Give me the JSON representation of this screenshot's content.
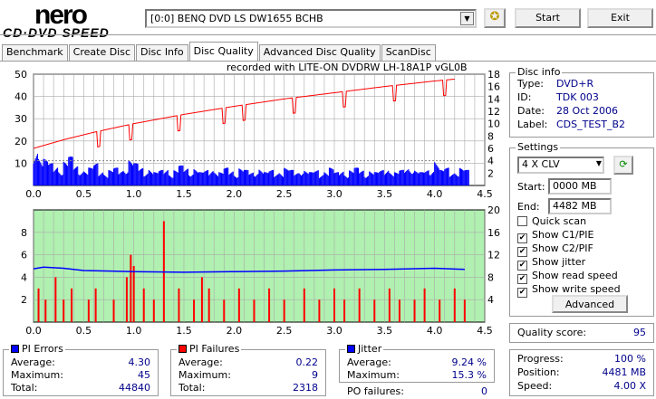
{
  "app": {
    "logo_top": "nero",
    "logo_bottom": "CD·DVD SPEED"
  },
  "toolbar": {
    "drive": "[0:0]  BENQ DVD LS DW1655 BCHB",
    "start_label": "Start",
    "exit_label": "Exit"
  },
  "tabs": [
    {
      "label": "Benchmark"
    },
    {
      "label": "Create Disc"
    },
    {
      "label": "Disc Info"
    },
    {
      "label": "Disc Quality",
      "active": true
    },
    {
      "label": "Advanced Disc Quality"
    },
    {
      "label": "ScanDisc"
    }
  ],
  "recorded_with": "recorded with LITE-ON DVDRW LH-18A1P    vGL0B",
  "disc_info": {
    "title": "Disc info",
    "type_label": "Type:",
    "type": "DVD+R",
    "id_label": "ID:",
    "id": "TDK 003",
    "date_label": "Date:",
    "date": "28 Oct 2006",
    "label_label": "Label:",
    "label": "CDS_TEST_B2"
  },
  "settings": {
    "title": "Settings",
    "speed": "4 X CLV",
    "start_label": "Start:",
    "start": "0000 MB",
    "end_label": "End:",
    "end": "4482 MB",
    "options": [
      {
        "label": "Quick scan",
        "checked": false
      },
      {
        "label": "Show C1/PIE",
        "checked": true
      },
      {
        "label": "Show C2/PIF",
        "checked": true
      },
      {
        "label": "Show jitter",
        "checked": true
      },
      {
        "label": "Show read speed",
        "checked": true
      },
      {
        "label": "Show write speed",
        "checked": true
      }
    ],
    "advanced_label": "Advanced"
  },
  "quality": {
    "label": "Quality score:",
    "value": "95"
  },
  "progress": {
    "progress_label": "Progress:",
    "progress": "100 %",
    "position_label": "Position:",
    "position": "4481 MB",
    "speed_label": "Speed:",
    "speed": "4.00 X"
  },
  "pi_errors": {
    "title": "PI Errors",
    "avg_label": "Average:",
    "avg": "4.30",
    "max_label": "Maximum:",
    "max": "45",
    "total_label": "Total:",
    "total": "44840"
  },
  "pi_failures": {
    "title": "PI Failures",
    "avg_label": "Average:",
    "avg": "0.22",
    "max_label": "Maximum:",
    "max": "9",
    "total_label": "Total:",
    "total": "2318"
  },
  "jitter": {
    "title": "Jitter",
    "avg_label": "Average:",
    "avg": "9.24 %",
    "max_label": "Maximum:",
    "max": "15.3 %",
    "po_label": "PO failures:",
    "po": "0"
  },
  "colors": {
    "pie": "#0000ff",
    "pif": "#ff0000",
    "jitter": "#0000ff",
    "write_speed": "#ff0000",
    "bottom_bg": "#b0f0b0"
  },
  "chart_data": [
    {
      "type": "bar",
      "title": "PI Errors / Speed",
      "xlim": [
        0,
        4.5
      ],
      "ylim": [
        0,
        50
      ],
      "y2lim": [
        0,
        18
      ],
      "xticks": [
        "0.0",
        "0.5",
        "1.0",
        "1.5",
        "2.0",
        "2.5",
        "3.0",
        "3.5",
        "4.0",
        "4.5"
      ],
      "yticks": [
        "10",
        "20",
        "30",
        "40",
        "50"
      ],
      "y2ticks": [
        "2",
        "4",
        "6",
        "8",
        "10",
        "12",
        "14",
        "16",
        "18"
      ],
      "pie_x_step": 0.05,
      "pie": [
        18,
        14,
        12,
        10,
        9,
        8,
        11,
        13,
        9,
        8,
        7,
        8,
        10,
        7,
        6,
        7,
        8,
        7,
        9,
        12,
        10,
        8,
        7,
        8,
        6,
        7,
        8,
        6,
        7,
        9,
        8,
        7,
        8,
        6,
        7,
        8,
        7,
        6,
        8,
        7,
        6,
        8,
        7,
        6,
        7,
        8,
        6,
        7,
        6,
        7,
        8,
        7,
        6,
        8,
        7,
        6,
        7,
        6,
        7,
        8,
        6,
        7,
        6,
        7,
        8,
        7,
        6,
        7,
        6,
        7,
        8,
        7,
        6,
        7,
        8,
        9,
        7,
        6,
        7,
        8,
        12,
        7,
        8,
        6,
        7,
        8,
        7
      ],
      "write_speed": {
        "x": [
          0,
          0.3,
          0.6,
          1.0,
          1.5,
          2.0,
          2.5,
          3.0,
          3.5,
          4.0,
          4.2
        ],
        "y": [
          6,
          7.4,
          8.6,
          10,
          11.5,
          12.8,
          14,
          15,
          16,
          16.9,
          17.2
        ],
        "dips_at": [
          0.65,
          0.97,
          1.45,
          1.9,
          2.1,
          2.6,
          3.1,
          3.6,
          4.1
        ]
      },
      "read_speed": 4
    },
    {
      "type": "bar",
      "title": "PI Failures / Jitter",
      "xlim": [
        0,
        4.5
      ],
      "ylim": [
        0,
        10
      ],
      "y2lim": [
        0,
        20
      ],
      "xticks": [
        "0.0",
        "0.5",
        "1.0",
        "1.5",
        "2.0",
        "2.5",
        "3.0",
        "3.5",
        "4.0",
        "4.5"
      ],
      "yticks": [
        "2",
        "4",
        "6",
        "8"
      ],
      "y2ticks": [
        "4",
        "8",
        "12",
        "16",
        "20"
      ],
      "pif": [
        [
          0.05,
          3
        ],
        [
          0.12,
          2
        ],
        [
          0.22,
          4
        ],
        [
          0.3,
          2
        ],
        [
          0.38,
          3
        ],
        [
          0.55,
          2
        ],
        [
          0.62,
          3
        ],
        [
          0.8,
          2
        ],
        [
          0.93,
          4
        ],
        [
          0.97,
          6
        ],
        [
          1.0,
          5
        ],
        [
          1.1,
          3
        ],
        [
          1.2,
          2
        ],
        [
          1.3,
          9
        ],
        [
          1.45,
          3
        ],
        [
          1.6,
          2
        ],
        [
          1.68,
          4
        ],
        [
          1.75,
          3
        ],
        [
          1.9,
          2
        ],
        [
          2.05,
          3
        ],
        [
          2.2,
          2
        ],
        [
          2.35,
          3
        ],
        [
          2.5,
          2
        ],
        [
          2.7,
          3
        ],
        [
          2.85,
          2
        ],
        [
          3.0,
          3
        ],
        [
          3.1,
          2
        ],
        [
          3.25,
          3
        ],
        [
          3.4,
          2
        ],
        [
          3.55,
          3
        ],
        [
          3.65,
          2
        ],
        [
          3.8,
          2
        ],
        [
          3.9,
          3
        ],
        [
          4.05,
          2
        ],
        [
          4.2,
          3
        ],
        [
          4.3,
          2
        ]
      ],
      "jitter": {
        "x": [
          0,
          0.1,
          0.3,
          0.5,
          1.0,
          1.5,
          2.0,
          2.5,
          3.0,
          3.5,
          4.0,
          4.3
        ],
        "y": [
          9.5,
          9.8,
          9.6,
          9.2,
          9.0,
          8.9,
          9.0,
          9.1,
          9.3,
          9.4,
          9.6,
          9.4
        ]
      }
    }
  ]
}
